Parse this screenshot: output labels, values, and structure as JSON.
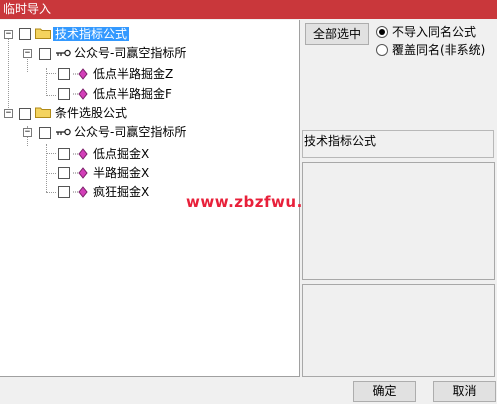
{
  "window": {
    "title": "临时导入"
  },
  "tree": {
    "nodes": [
      {
        "label": "技术指标公式",
        "selected": true
      },
      {
        "label": "公众号-司赢空指标所"
      },
      {
        "label": "低点半路掘金Z"
      },
      {
        "label": "低点半路掘金F"
      },
      {
        "label": "条件选股公式"
      },
      {
        "label": "公众号-司赢空指标所"
      },
      {
        "label": "低点掘金X"
      },
      {
        "label": "半路掘金X"
      },
      {
        "label": "疯狂掘金X"
      }
    ]
  },
  "right": {
    "select_all_label": "全部选中",
    "radio_options": [
      {
        "label": "不导入同名公式",
        "checked": true
      },
      {
        "label": "覆盖同名(非系统)",
        "checked": false
      }
    ],
    "info_label": "技术指标公式"
  },
  "watermark": "www.zbzfwu.com",
  "buttons": {
    "ok": "确定",
    "cancel": "取消"
  }
}
